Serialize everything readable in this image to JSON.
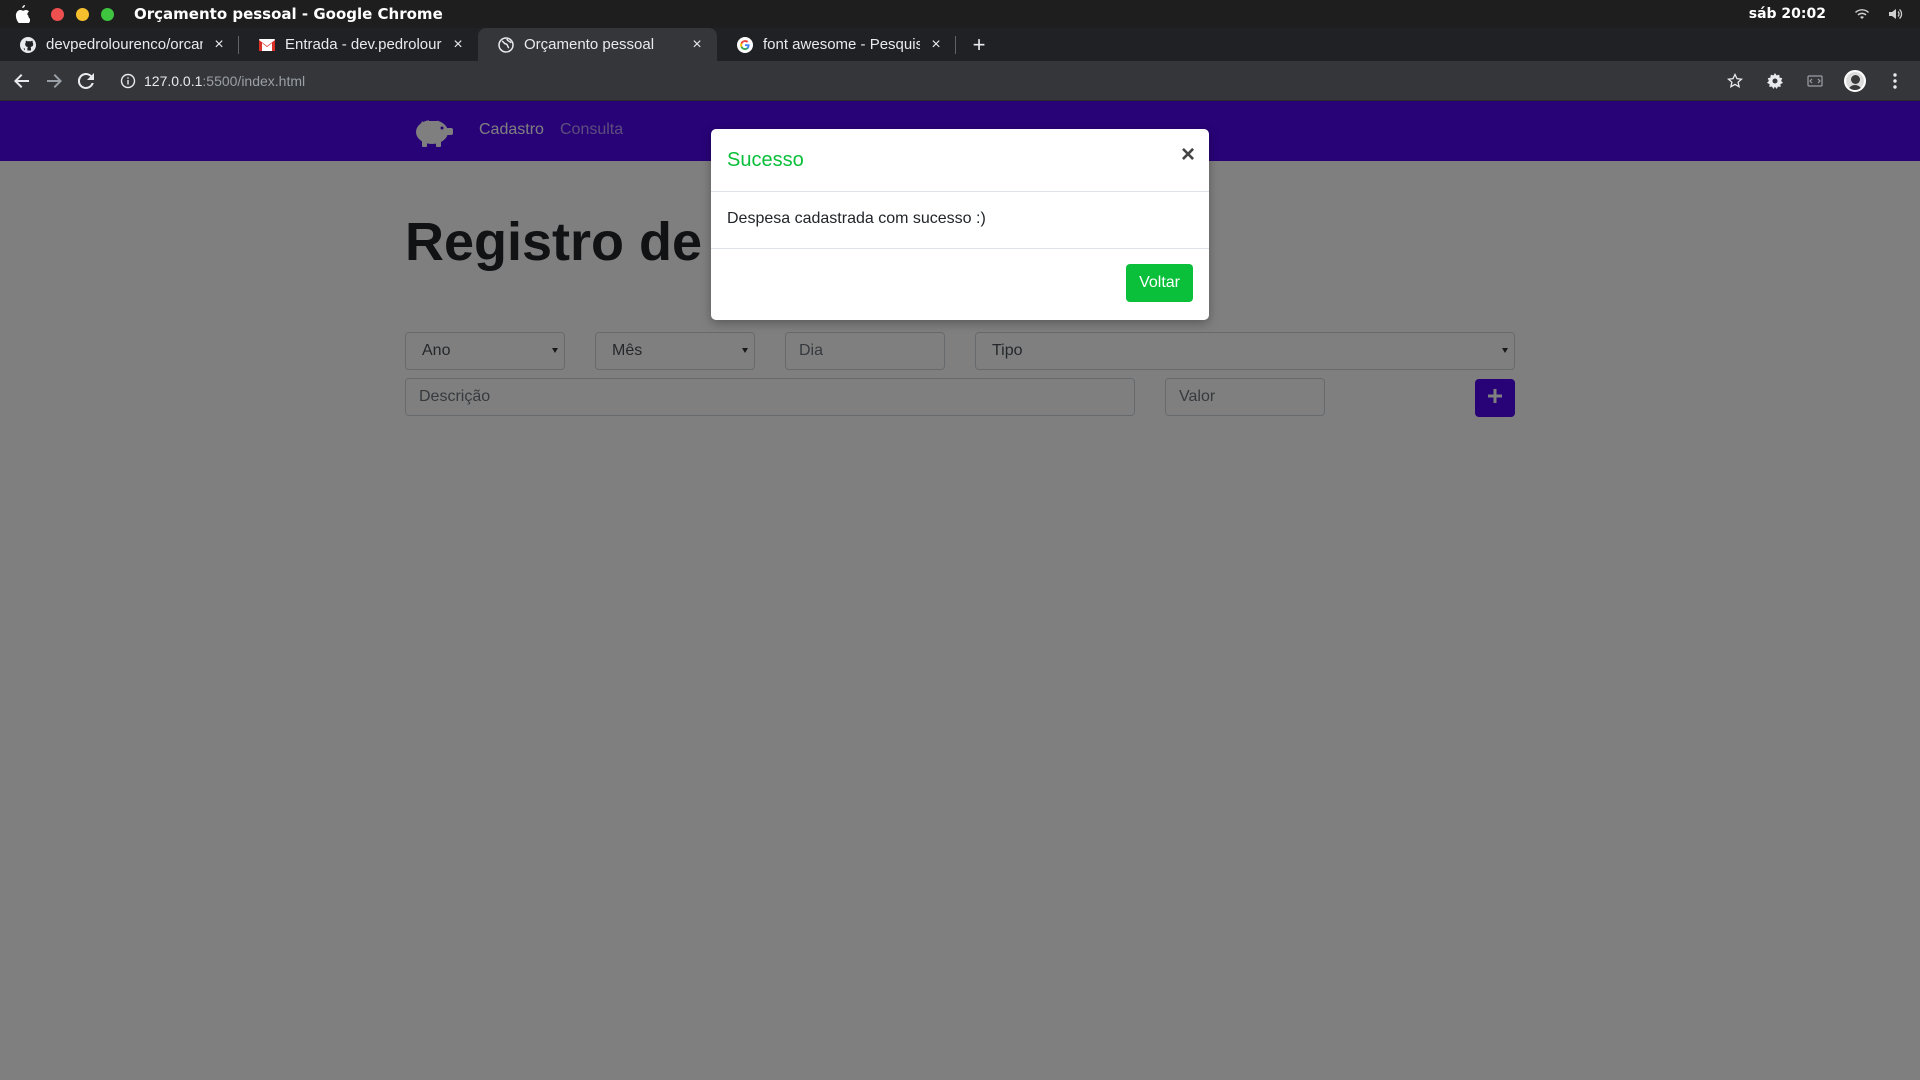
{
  "os": {
    "window_title": "Orçamento pessoal - Google Chrome",
    "clock": "sáb 20:02",
    "icons": [
      "apple-icon",
      "wifi-icon",
      "volume-icon"
    ]
  },
  "browser": {
    "tabs": [
      {
        "label": "devpedrolourenco/orcamento",
        "icon": "github-icon",
        "active": false
      },
      {
        "label": "Entrada - dev.pedrolourenco",
        "icon": "gmail-icon",
        "active": false
      },
      {
        "label": "Orçamento pessoal",
        "icon": "globe-icon",
        "active": true
      },
      {
        "label": "font awesome - Pesquisa Google",
        "icon": "google-icon",
        "active": false
      }
    ],
    "url_host": "127.0.0.1",
    "url_rest": ":5500/index.html"
  },
  "navbar": {
    "brand_icon": "piggy-bank-icon",
    "links": [
      "Cadastro",
      "Consulta"
    ]
  },
  "form": {
    "heading": "Registro de",
    "ano_placeholder": "Ano",
    "mes_placeholder": "Mês",
    "dia_placeholder": "Dia",
    "tipo_placeholder": "Tipo",
    "descricao_placeholder": "Descrição",
    "valor_placeholder": "Valor",
    "add_button_icon": "plus-icon"
  },
  "modal": {
    "title": "Sucesso",
    "message": "Despesa cadastrada com sucesso :)",
    "button": "Voltar",
    "close_symbol": "×",
    "accent_color": "#0abf3a"
  },
  "colors": {
    "brand_purple": "#5006f0",
    "success_green": "#0abf3a"
  }
}
